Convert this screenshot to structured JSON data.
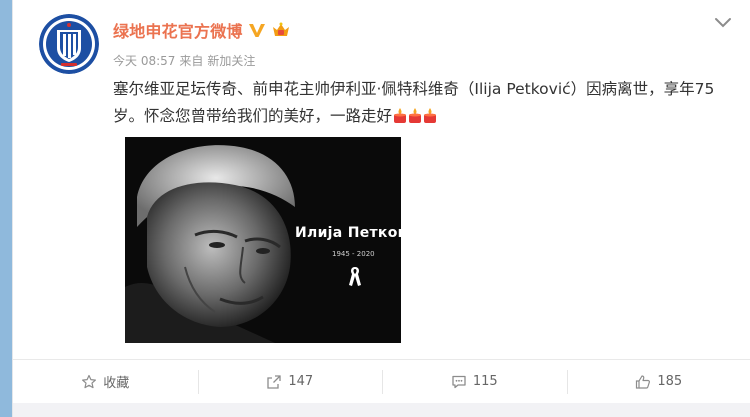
{
  "post": {
    "author": "绿地申花官方微博",
    "time": "今天 08:57",
    "from_prefix": "来自",
    "source": "新加关注",
    "text": "塞尔维亚足坛传奇、前申花主帅伊利亚·佩特科维奇（Ilija Petković）因病离世，享年75岁。怀念您曾带给我们的美好，一路走好"
  },
  "photo": {
    "name": "Илија Петков",
    "years": "1945 - 2020"
  },
  "actions": {
    "favorite": "收藏",
    "share": "147",
    "comment": "115",
    "like": "185"
  },
  "colors": {
    "author": "#eb7350",
    "verified": "#f5a623",
    "background": "#8fb9dc"
  }
}
